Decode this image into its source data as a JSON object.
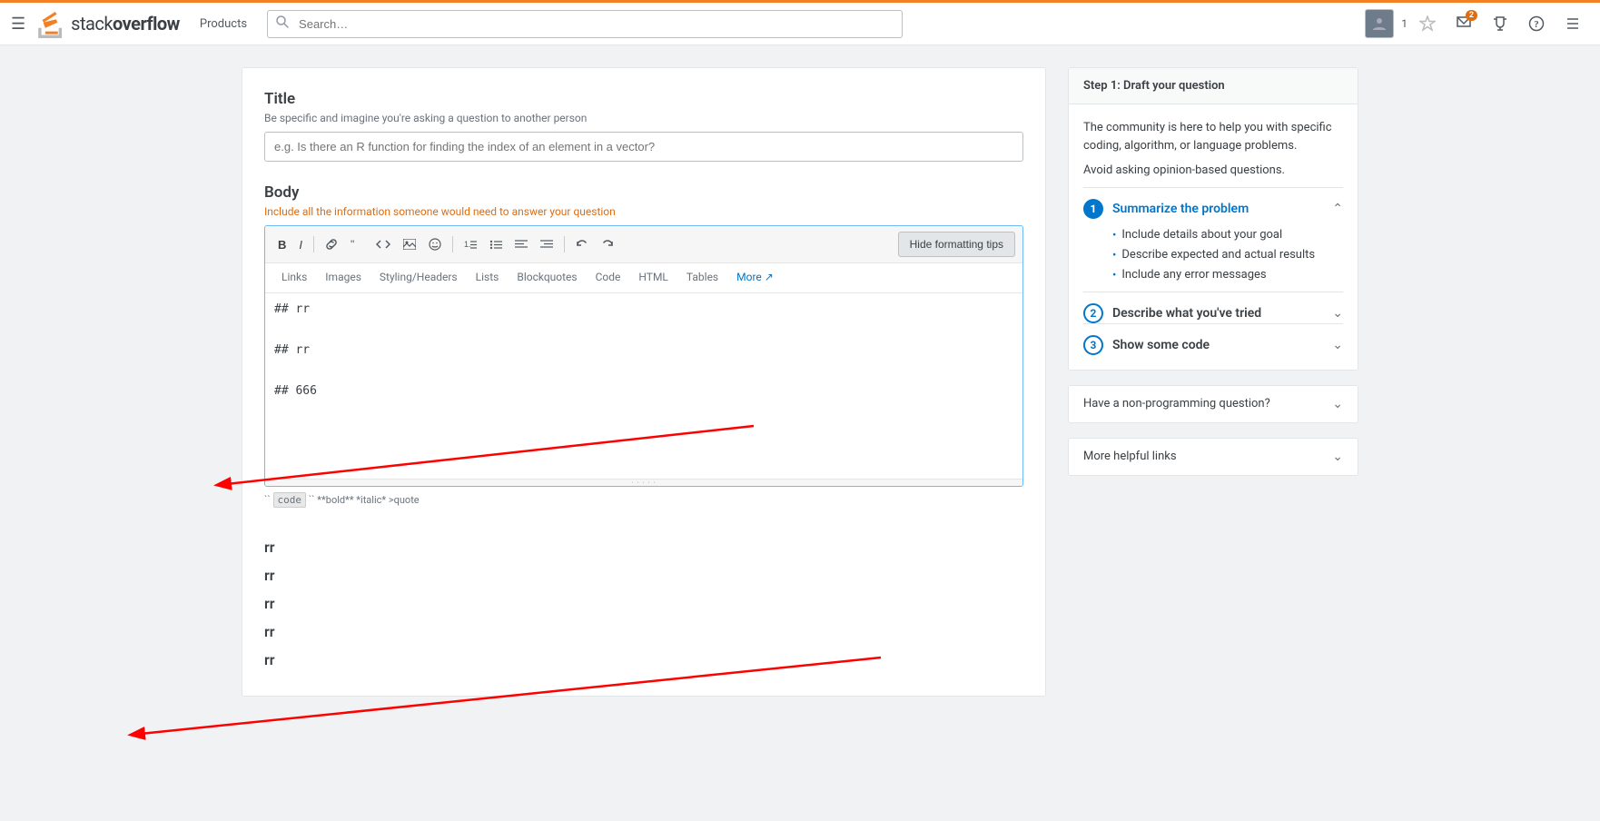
{
  "navbar": {
    "hamburger_label": "☰",
    "logo_text_light": "stack",
    "logo_text_bold": "overflow",
    "products_label": "Products",
    "search_placeholder": "Search…",
    "rep_label": "1",
    "notifications_badge": "2"
  },
  "page": {
    "title_field_label": "Title",
    "title_field_hint": "Be specific and imagine you're asking a question to another person",
    "title_placeholder": "e.g. Is there an R function for finding the index of an element in a vector?",
    "body_field_label": "Body",
    "body_field_hint": "Include all the information someone would need to answer your question",
    "hide_tips_label": "Hide formatting tips",
    "toolbar_tabs": [
      "Links",
      "Images",
      "Styling/Headers",
      "Lists",
      "Blockquotes",
      "Code",
      "HTML",
      "Tables"
    ],
    "toolbar_more": "More ↗",
    "editor_content": "## rr\n\n## rr\n\n## 666",
    "md_hint": "`` ` ``code`` ` `` **bold** *italic* >quote",
    "preview_items": [
      "rr",
      "rr",
      "rr",
      "rr",
      "rr"
    ]
  },
  "sidebar": {
    "step1_title": "Step 1: Draft your question",
    "step1_desc1": "The community is here to help you with specific coding, algorithm, or language problems.",
    "step1_desc2": "Avoid asking opinion-based questions.",
    "summarize_label": "Summarize the problem",
    "summarize_bullets": [
      "Include details about your goal",
      "Describe expected and actual results",
      "Include any error messages"
    ],
    "describe_tried_label": "Describe what you've tried",
    "show_code_label": "Show some code",
    "non_prog_label": "Have a non-programming question?",
    "helpful_links_label": "More helpful links"
  }
}
